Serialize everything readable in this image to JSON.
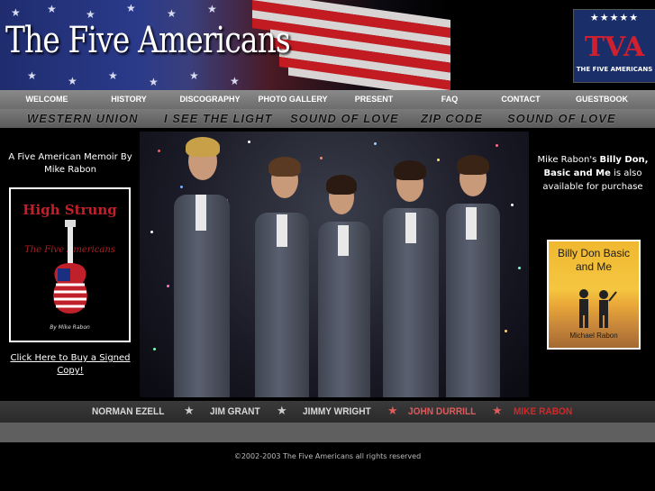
{
  "site": {
    "title": "The Five Americans",
    "logo_text": "TVA",
    "logo_tagline": "THE FIVE AMERICANS"
  },
  "nav": [
    "WELCOME",
    "HISTORY",
    "DISCOGRAPHY",
    "PHOTO GALLERY",
    "PRESENT",
    "FAQ",
    "CONTACT",
    "GUESTBOOK"
  ],
  "songs": [
    "WESTERN UNION",
    "I SEE THE LIGHT",
    "SOUND OF LOVE",
    "ZIP CODE",
    "SOUND OF LOVE"
  ],
  "left": {
    "memoir_text": "A Five American Memoir By Mike Rabon",
    "book_title": "High Strung",
    "book_subtitle": "The Five Americans",
    "book_author": "By Mike Rabon",
    "buy_link": "Click Here to Buy a Signed Copy!"
  },
  "right": {
    "promo_prefix": "Mike Rabon's",
    "promo_book": "Billy Don, Basic and Me",
    "promo_suffix": "is also available for purchase",
    "cover_title": "Billy Don Basic and Me",
    "cover_author": "Michael Rabon"
  },
  "members": [
    {
      "name": "NORMAN EZELL",
      "color": "#d8d8d8"
    },
    {
      "name": "JIM GRANT",
      "color": "#d8d8d8"
    },
    {
      "name": "JIMMY WRIGHT",
      "color": "#d8d8d8"
    },
    {
      "name": "JOHN DURRILL",
      "color": "#e25a5a"
    },
    {
      "name": "MIKE RABON",
      "color": "#d02a2a"
    }
  ],
  "footer": {
    "copyright": "©2002-2003 The Five Americans all rights reserved"
  },
  "icons": {
    "separator": "star-icon",
    "header_stars": "star-icon"
  }
}
